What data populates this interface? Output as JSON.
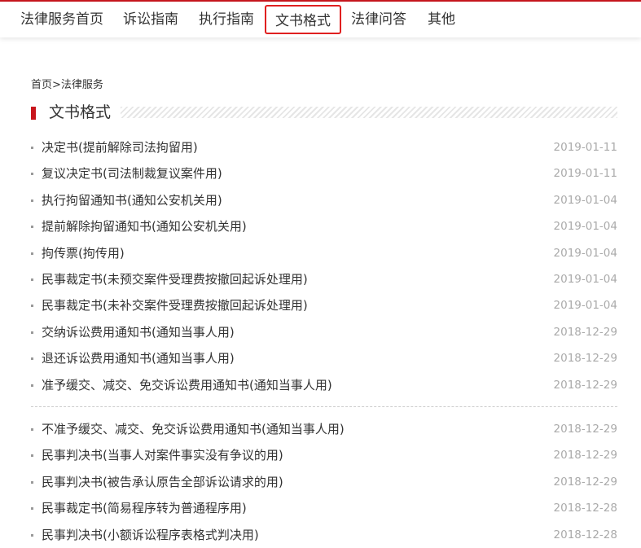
{
  "nav": {
    "items": [
      {
        "label": "法律服务首页"
      },
      {
        "label": "诉讼指南"
      },
      {
        "label": "执行指南"
      },
      {
        "label": "文书格式"
      },
      {
        "label": "法律问答"
      },
      {
        "label": "其他"
      }
    ],
    "active_index": 3
  },
  "breadcrumb": {
    "home": "首页",
    "separator": ">",
    "current": "法律服务"
  },
  "section": {
    "title": "文书格式"
  },
  "colors": {
    "accent": "#c8161d",
    "active_border": "#e02020",
    "date": "#aaaaaa"
  },
  "list_group_1": [
    {
      "title": "决定书(提前解除司法拘留用)",
      "date": "2019-01-11"
    },
    {
      "title": "复议决定书(司法制裁复议案件用)",
      "date": "2019-01-11"
    },
    {
      "title": "执行拘留通知书(通知公安机关用)",
      "date": "2019-01-04"
    },
    {
      "title": "提前解除拘留通知书(通知公安机关用)",
      "date": "2019-01-04"
    },
    {
      "title": "拘传票(拘传用)",
      "date": "2019-01-04"
    },
    {
      "title": "民事裁定书(未预交案件受理费按撤回起诉处理用)",
      "date": "2019-01-04"
    },
    {
      "title": "民事裁定书(未补交案件受理费按撤回起诉处理用)",
      "date": "2019-01-04"
    },
    {
      "title": "交纳诉讼费用通知书(通知当事人用)",
      "date": "2018-12-29"
    },
    {
      "title": "退还诉讼费用通知书(通知当事人用)",
      "date": "2018-12-29"
    },
    {
      "title": "准予缓交、减交、免交诉讼费用通知书(通知当事人用)",
      "date": "2018-12-29"
    }
  ],
  "list_group_2": [
    {
      "title": "不准予缓交、减交、免交诉讼费用通知书(通知当事人用)",
      "date": "2018-12-29"
    },
    {
      "title": "民事判决书(当事人对案件事实没有争议的用)",
      "date": "2018-12-29"
    },
    {
      "title": "民事判决书(被告承认原告全部诉讼请求的用)",
      "date": "2018-12-29"
    },
    {
      "title": "民事裁定书(简易程序转为普通程序用)",
      "date": "2018-12-28"
    },
    {
      "title": "民事判决书(小额诉讼程序表格式判决用)",
      "date": "2018-12-28"
    }
  ]
}
